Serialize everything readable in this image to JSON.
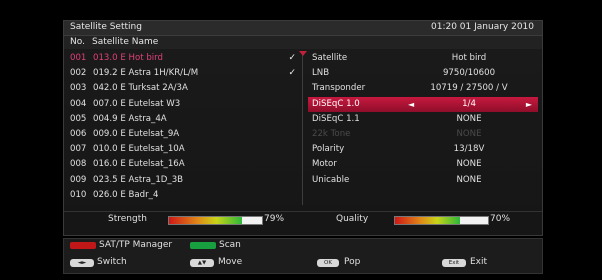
{
  "header": {
    "title": "Satellite Setting",
    "datetime": "01:20 01 January 2010"
  },
  "columns": {
    "no": "No.",
    "name": "Satellite Name"
  },
  "satellites": [
    {
      "num": "001",
      "name": "013.0 E Hot bird",
      "checked": true,
      "selected": true
    },
    {
      "num": "002",
      "name": "019.2 E Astra 1H/KR/L/M",
      "checked": true,
      "selected": false
    },
    {
      "num": "003",
      "name": "042.0 E Turksat 2A/3A",
      "checked": false,
      "selected": false
    },
    {
      "num": "004",
      "name": "007.0 E Eutelsat W3",
      "checked": false,
      "selected": false
    },
    {
      "num": "005",
      "name": "004.9 E Astra_4A",
      "checked": false,
      "selected": false
    },
    {
      "num": "006",
      "name": "009.0 E Eutelsat_9A",
      "checked": false,
      "selected": false
    },
    {
      "num": "007",
      "name": "010.0 E Eutelsat_10A",
      "checked": false,
      "selected": false
    },
    {
      "num": "008",
      "name": "016.0 E Eutelsat_16A",
      "checked": false,
      "selected": false
    },
    {
      "num": "009",
      "name": "023.5 E Astra_1D_3B",
      "checked": false,
      "selected": false
    },
    {
      "num": "010",
      "name": "026.0 E Badr_4",
      "checked": false,
      "selected": false
    }
  ],
  "check_glyph": "✓",
  "params": [
    {
      "label": "Satellite",
      "value": "Hot bird",
      "state": "normal"
    },
    {
      "label": "LNB",
      "value": "9750/10600",
      "state": "normal"
    },
    {
      "label": "Transponder",
      "value": "10719 / 27500 / V",
      "state": "normal"
    },
    {
      "label": "DiSEqC 1.0",
      "value": "1/4",
      "state": "active"
    },
    {
      "label": "DiSEqC 1.1",
      "value": "NONE",
      "state": "normal"
    },
    {
      "label": "22k Tone",
      "value": "NONE",
      "state": "disabled"
    },
    {
      "label": "Polarity",
      "value": "13/18V",
      "state": "normal"
    },
    {
      "label": "Motor",
      "value": "NONE",
      "state": "normal"
    },
    {
      "label": "Unicable",
      "value": "NONE",
      "state": "normal"
    }
  ],
  "signal": {
    "strength_label": "Strength",
    "strength_pct": "79%",
    "strength_value": 0.79,
    "quality_label": "Quality",
    "quality_pct": "70%",
    "quality_value": 0.7
  },
  "help": {
    "sat_tp_manager": "SAT/TP Manager",
    "scan": "Scan",
    "switch": "Switch",
    "move": "Move",
    "pop": "Pop",
    "exit": "Exit",
    "switch_key": "◄►",
    "move_key": "▲▼",
    "ok_key": "OK",
    "exit_key": "Exit"
  },
  "colors": {
    "accent": "#c8193f",
    "selected_text": "#e0407a",
    "key_red": "#c01818",
    "key_green": "#18a040"
  }
}
